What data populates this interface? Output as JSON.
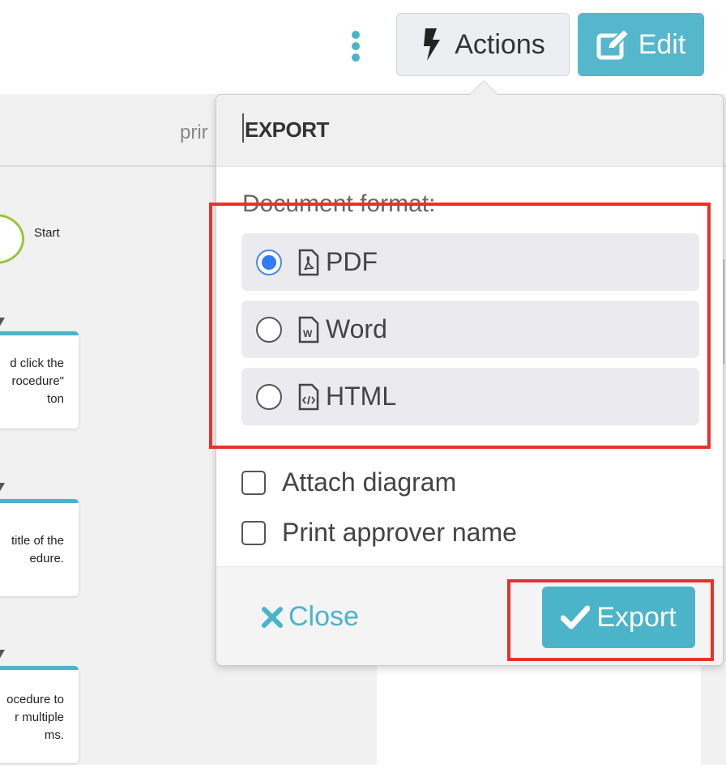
{
  "toolbar": {
    "actions_label": "Actions",
    "edit_label": "Edit"
  },
  "canvas": {
    "header_partial": "prir",
    "start_label": "Start",
    "steps": [
      "d click the\nrocedure\"\nton",
      "title of the\nedure.",
      "ocedure to\nr multiple\nms."
    ]
  },
  "export": {
    "title": "EXPORT",
    "format_label": "Document format:",
    "options": [
      {
        "label": "PDF",
        "selected": true,
        "icon": "file-pdf-icon"
      },
      {
        "label": "Word",
        "selected": false,
        "icon": "file-word-icon"
      },
      {
        "label": "HTML",
        "selected": false,
        "icon": "file-code-icon"
      }
    ],
    "checkboxes": [
      {
        "label": "Attach diagram",
        "checked": false
      },
      {
        "label": "Print approver name",
        "checked": false
      }
    ],
    "close_label": "Close",
    "export_label": "Export"
  },
  "colors": {
    "accent": "#4cb4c8",
    "highlight": "#e8312a",
    "radio": "#2f7cf6"
  }
}
